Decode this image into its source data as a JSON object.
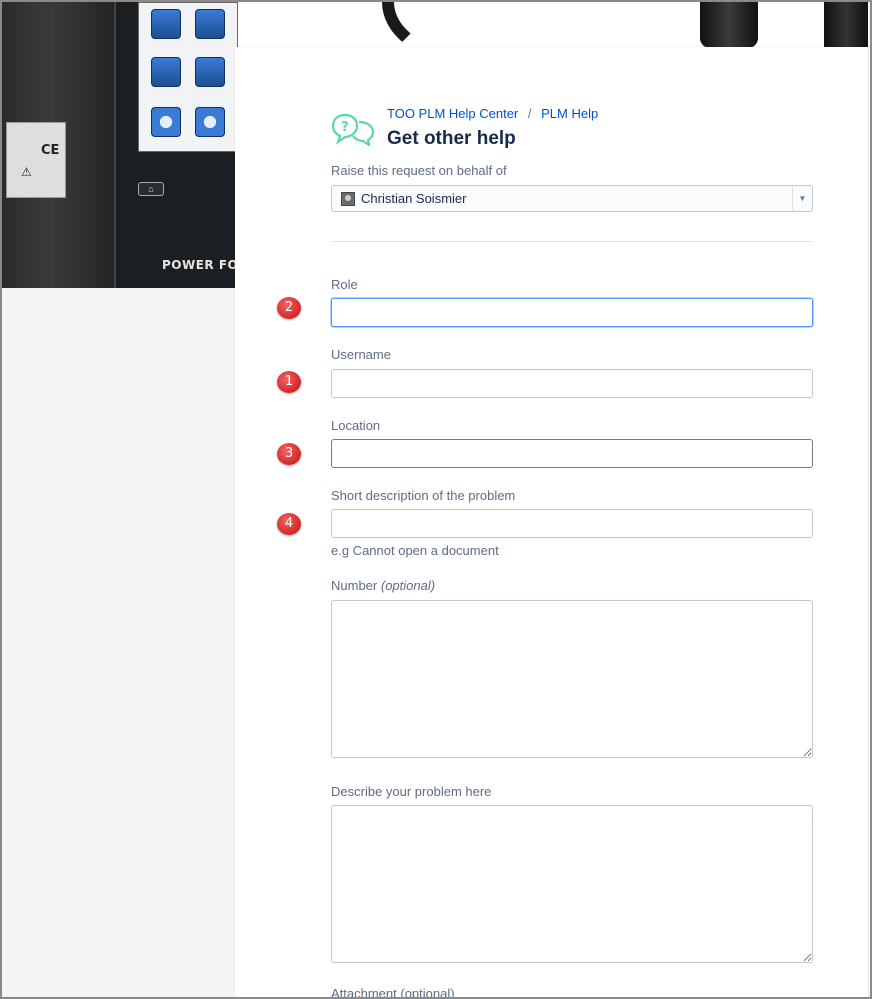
{
  "banner": {
    "brand_text": "POWER FOC",
    "label_ce": "CE",
    "label_warn": "⚠",
    "home_glyph": "⌂",
    "icon": "product-photo"
  },
  "breadcrumb": {
    "portal": "TOO PLM Help Center",
    "separator": "/",
    "service_desk": "PLM Help"
  },
  "page": {
    "title": "Get other help",
    "icon": "help-chat-icon",
    "icon_color": "#57d9a3"
  },
  "on_behalf": {
    "label": "Raise this request on behalf of",
    "value": "Christian Soismier",
    "arrow": "▼"
  },
  "fields": {
    "role": {
      "label": "Role",
      "value": "",
      "marker": "2"
    },
    "username": {
      "label": "Username",
      "value": "",
      "marker": "1"
    },
    "location": {
      "label": "Location",
      "value": "",
      "marker": "3"
    },
    "short_description": {
      "label": "Short description of the problem",
      "value": "",
      "hint": "e.g Cannot open a document",
      "marker": "4"
    },
    "number": {
      "label": "Number",
      "optional": "(optional)",
      "value": ""
    },
    "describe": {
      "label": "Describe your problem here",
      "value": ""
    },
    "attachment": {
      "label": "Attachment (optional)"
    }
  },
  "colors": {
    "link": "#0052cc",
    "marker": "#d42626",
    "focus": "#4c9aff"
  }
}
